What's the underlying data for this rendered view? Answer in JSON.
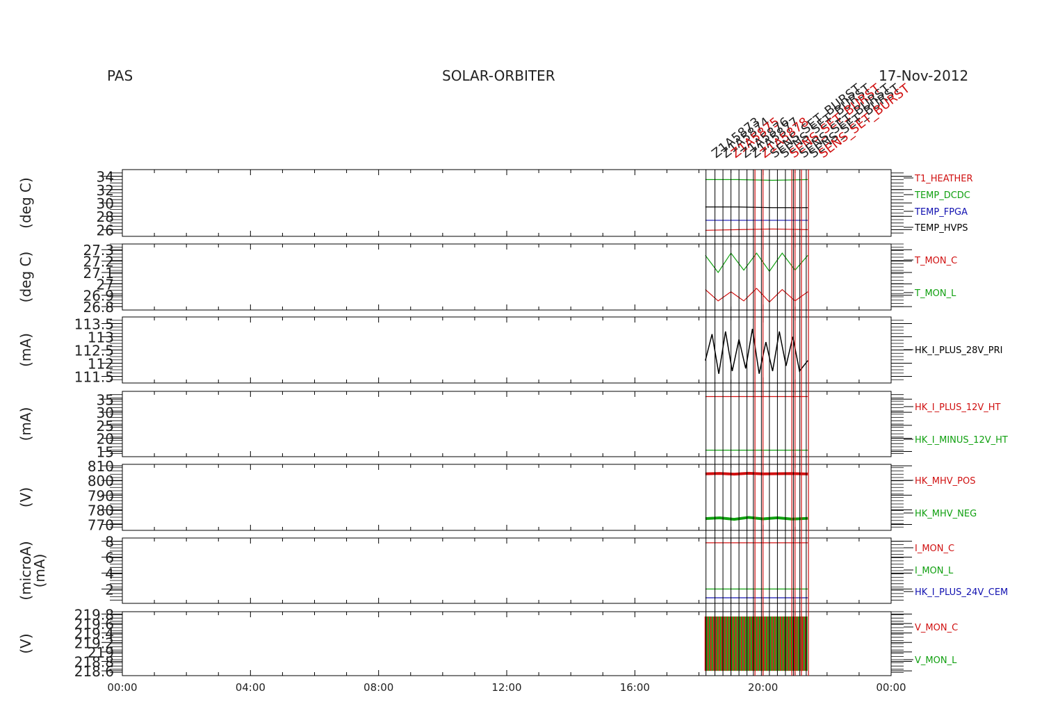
{
  "header": {
    "left": "PAS",
    "center": "SOLAR-ORBITER",
    "right": "17-Nov-2012"
  },
  "x_axis": {
    "tick_labels": [
      "00:00",
      "04:00",
      "08:00",
      "12:00",
      "16:00",
      "20:00",
      "00:00"
    ],
    "range_hours": [
      0,
      24
    ]
  },
  "colors": {
    "red": "#d01010",
    "green": "#10a010",
    "blue": "#1010b0",
    "black": "#000000"
  },
  "events": {
    "stacked_labels": [
      "Z1A5873",
      "Z1A5874",
      "Z1A5875",
      "Z1A5876",
      "Z1A5877",
      "Z1A5878",
      "SENS_SET_BURST",
      "SENS_SET_BURST",
      "SENS_SET_BURST",
      "SENS_SET_BURST",
      "SENS_SET_BURST",
      "SENS_SET_BURST"
    ],
    "black_lines_hours": [
      18.22,
      18.5,
      18.75,
      19.0,
      19.25,
      19.5,
      19.7,
      19.95,
      20.2,
      20.45,
      20.7,
      20.95,
      21.15,
      21.35
    ],
    "red_lines_hours": [
      19.75,
      20.0,
      20.9,
      21.0,
      21.2,
      21.42
    ]
  },
  "chart_data": [
    {
      "type": "line",
      "ylabel": "(deg C)",
      "ylim": [
        25,
        35
      ],
      "yticks": [
        26,
        28,
        30,
        32,
        34
      ],
      "series": [
        {
          "name": "T1_HEATHER",
          "color": "#d01010",
          "values": [
            25.9,
            26.0,
            26.1,
            26.0
          ]
        },
        {
          "name": "TEMP_DCDC",
          "color": "#10a010",
          "values": [
            33.5,
            33.5,
            33.4,
            33.5
          ]
        },
        {
          "name": "TEMP_FPGA",
          "color": "#1010b0",
          "values": [
            27.4,
            27.4,
            27.4,
            27.4
          ]
        },
        {
          "name": "TEMP_HVPS",
          "color": "#000000",
          "values": [
            29.4,
            29.4,
            29.3,
            29.3
          ]
        }
      ],
      "x_hours": [
        18.2,
        19.2,
        20.3,
        21.4
      ]
    },
    {
      "type": "line",
      "ylabel": "(deg C)",
      "ylim": [
        26.77,
        27.35
      ],
      "yticks": [
        26.8,
        26.9,
        27.0,
        27.1,
        27.2,
        27.3
      ],
      "series": [
        {
          "name": "T_MON_C",
          "color": "#d01010",
          "values": [
            26.95,
            26.85,
            26.93,
            26.85,
            26.96,
            26.84,
            26.95,
            26.85,
            26.93
          ]
        },
        {
          "name": "T_MON_L",
          "color": "#10a010",
          "values": [
            27.25,
            27.1,
            27.27,
            27.12,
            27.27,
            27.11,
            27.27,
            27.12,
            27.25
          ]
        }
      ],
      "x_hours": [
        18.2,
        18.6,
        19.0,
        19.4,
        19.8,
        20.2,
        20.6,
        21.0,
        21.4
      ]
    },
    {
      "type": "line",
      "ylabel": "(mA)",
      "ylim": [
        111.25,
        113.75
      ],
      "yticks": [
        111.5,
        112.0,
        112.5,
        113.0,
        113.5
      ],
      "series": [
        {
          "name": "HK_I_PLUS_28V_PRI",
          "color": "#000000",
          "values": [
            112.1,
            113.1,
            111.6,
            113.2,
            111.7,
            112.9,
            111.8,
            113.3,
            111.6,
            112.8,
            111.7,
            113.2,
            111.9,
            113.0,
            111.7,
            112.1
          ]
        }
      ],
      "x_hours": [
        18.2,
        18.41,
        18.62,
        18.83,
        19.04,
        19.25,
        19.46,
        19.67,
        19.88,
        20.09,
        20.3,
        20.51,
        20.72,
        20.93,
        21.14,
        21.4
      ]
    },
    {
      "type": "line",
      "ylabel": "(mA)",
      "ylim": [
        13,
        38
      ],
      "yticks": [
        15,
        20,
        25,
        30,
        35
      ],
      "series": [
        {
          "name": "HK_I_PLUS_12V_HT",
          "color": "#d01010",
          "values": [
            36.0,
            36.0,
            36.0,
            36.0
          ]
        },
        {
          "name": "HK_I_MINUS_12V_HT",
          "color": "#10a010",
          "values": [
            15.5,
            15.5,
            15.5,
            15.5
          ]
        }
      ],
      "x_hours": [
        18.2,
        19.2,
        20.3,
        21.4
      ]
    },
    {
      "type": "line",
      "ylabel": "(V)",
      "ylim": [
        766,
        811
      ],
      "yticks": [
        770,
        780,
        790,
        800,
        810
      ],
      "series": [
        {
          "name": "HK_MHV_POS",
          "color": "#d01010",
          "values": [
            804.5,
            804.8,
            804.3,
            804.9,
            804.5,
            804.6,
            804.7,
            804.4
          ]
        },
        {
          "name": "HK_MHV_NEG",
          "color": "#10a010",
          "values": [
            774.0,
            774.5,
            773.5,
            774.8,
            773.8,
            774.6,
            773.7,
            774.2
          ]
        }
      ],
      "x_hours": [
        18.2,
        18.65,
        19.1,
        19.55,
        20.0,
        20.45,
        20.9,
        21.4
      ]
    },
    {
      "type": "line",
      "ylabel": "(microA)",
      "ylabel2": "(mA)",
      "ylim": [
        0.2,
        8.4
      ],
      "yticks": [
        2,
        4,
        6,
        8
      ],
      "series": [
        {
          "name": "I_MON_C",
          "color": "#d01010",
          "values": [
            7.8,
            7.8,
            7.8,
            7.8
          ]
        },
        {
          "name": "I_MON_L",
          "color": "#10a010",
          "values": [
            2.0,
            2.0,
            2.0,
            2.0
          ]
        },
        {
          "name": "HK_I_PLUS_24V_CEM",
          "color": "#1010b0",
          "values": [
            0.9,
            0.9,
            0.9,
            0.9
          ]
        }
      ],
      "x_hours": [
        18.2,
        19.2,
        20.3,
        21.4
      ]
    },
    {
      "type": "area",
      "ylabel": "(V)",
      "ylim": [
        218.5,
        219.85
      ],
      "yticks": [
        218.6,
        218.8,
        219.0,
        219.2,
        219.4,
        219.6,
        219.8
      ],
      "series": [
        {
          "name": "V_MON_C",
          "color": "#d01010",
          "values": [
            218.6,
            219.75
          ]
        },
        {
          "name": "V_MON_L",
          "color": "#10a010",
          "values": [
            218.6,
            219.75
          ]
        }
      ],
      "x_hours": [
        18.2,
        21.4
      ]
    }
  ]
}
